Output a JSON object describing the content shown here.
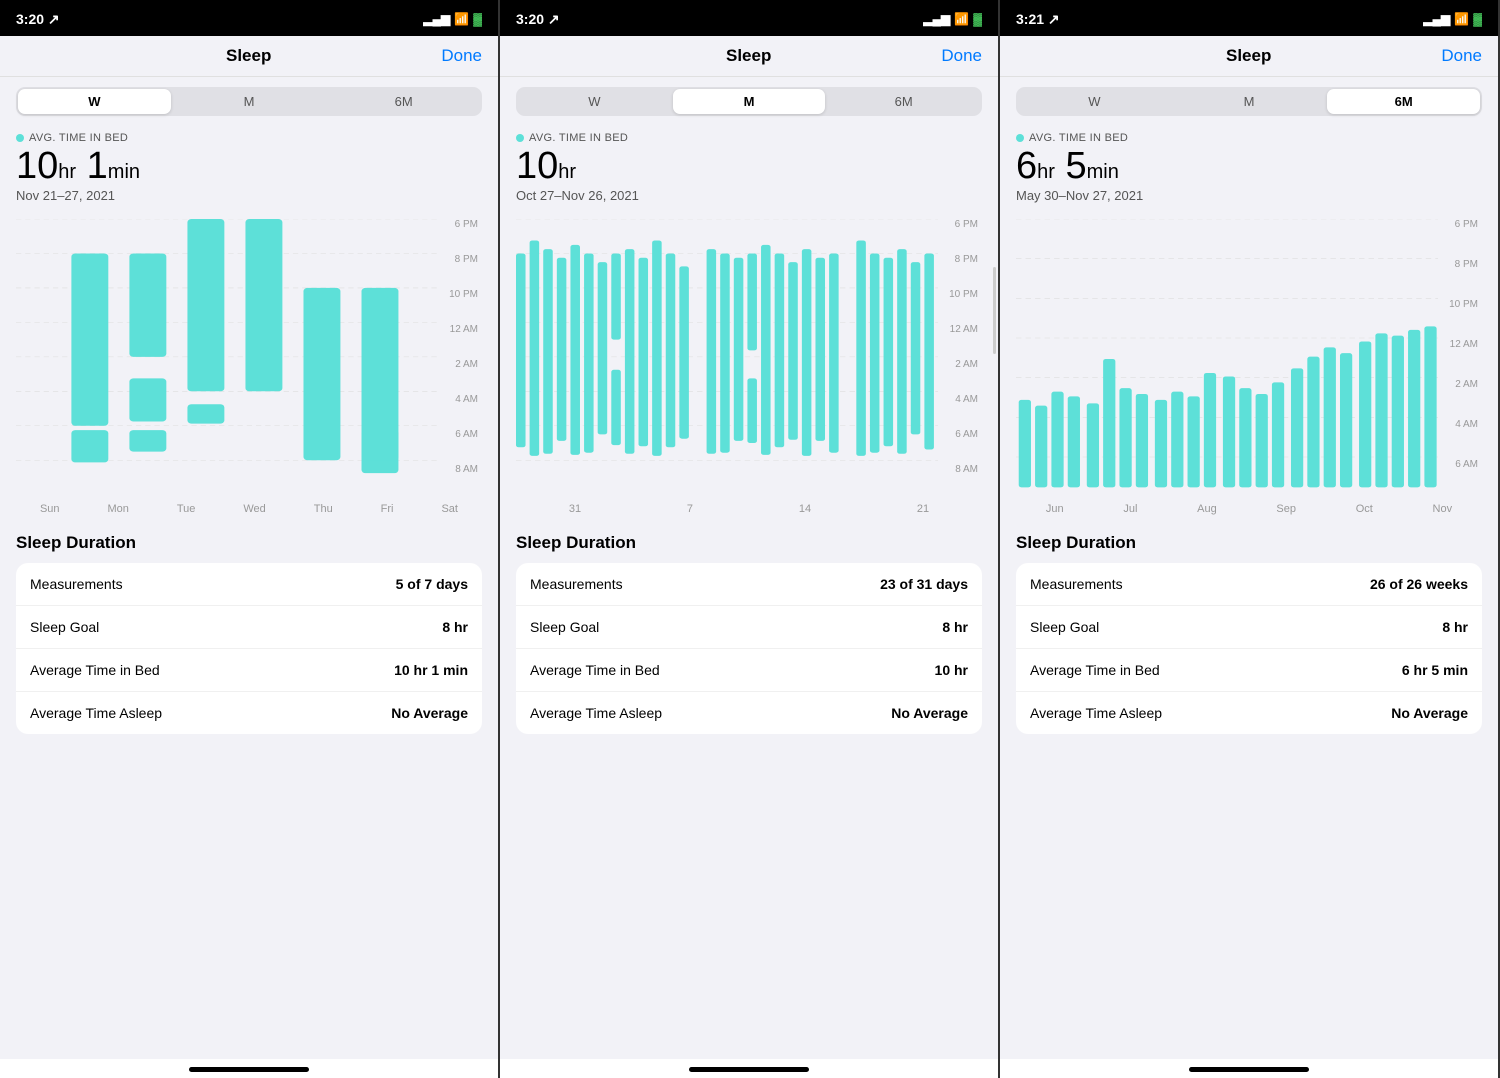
{
  "screens": [
    {
      "id": "weekly",
      "statusBar": {
        "time": "3:20",
        "locationIcon": "↗",
        "signal": "▂▄▆",
        "wifi": "wifi",
        "battery": "🔋"
      },
      "nav": {
        "title": "Sleep",
        "doneLabel": "Done"
      },
      "segments": [
        "W",
        "M",
        "6M"
      ],
      "activeSegment": 0,
      "avgLabel": "AVG. TIME IN BED",
      "bigValue": "10",
      "bigValueUnit": "hr",
      "bigValueMin": "1",
      "bigValueMinUnit": "min",
      "dateRange": "Nov 21–27, 2021",
      "timeLabels": [
        "6 PM",
        "8 PM",
        "10 PM",
        "12 AM",
        "2 AM",
        "4 AM",
        "6 AM",
        "8 AM"
      ],
      "xLabels": [
        "Sun",
        "Mon",
        "Tue",
        "Wed",
        "Thu",
        "Fri",
        "Sat"
      ],
      "statsTitle": "Sleep Duration",
      "stats": [
        {
          "label": "Measurements",
          "value": "5 of 7 days"
        },
        {
          "label": "Sleep Goal",
          "value": "8 hr"
        },
        {
          "label": "Average Time in Bed",
          "value": "10 hr 1 min"
        },
        {
          "label": "Average Time Asleep",
          "value": "No Average"
        }
      ]
    },
    {
      "id": "monthly",
      "statusBar": {
        "time": "3:20",
        "locationIcon": "↗"
      },
      "nav": {
        "title": "Sleep",
        "doneLabel": "Done"
      },
      "segments": [
        "W",
        "M",
        "6M"
      ],
      "activeSegment": 1,
      "avgLabel": "AVG. TIME IN BED",
      "bigValue": "10",
      "bigValueUnit": "hr",
      "bigValueMin": "",
      "bigValueMinUnit": "",
      "dateRange": "Oct 27–Nov 26, 2021",
      "timeLabels": [
        "6 PM",
        "8 PM",
        "10 PM",
        "12 AM",
        "2 AM",
        "4 AM",
        "6 AM",
        "8 AM"
      ],
      "xLabels": [
        "31",
        "7",
        "14",
        "21"
      ],
      "statsTitle": "Sleep Duration",
      "stats": [
        {
          "label": "Measurements",
          "value": "23 of 31 days"
        },
        {
          "label": "Sleep Goal",
          "value": "8 hr"
        },
        {
          "label": "Average Time in Bed",
          "value": "10 hr"
        },
        {
          "label": "Average Time Asleep",
          "value": "No Average"
        }
      ],
      "hasScrollbar": true
    },
    {
      "id": "sixmonth",
      "statusBar": {
        "time": "3:21",
        "locationIcon": "↗"
      },
      "nav": {
        "title": "Sleep",
        "doneLabel": "Done"
      },
      "segments": [
        "W",
        "M",
        "6M"
      ],
      "activeSegment": 2,
      "avgLabel": "AVG. TIME IN BED",
      "bigValue": "6",
      "bigValueUnit": "hr",
      "bigValueMin": "5",
      "bigValueMinUnit": "min",
      "dateRange": "May 30–Nov 27, 2021",
      "timeLabels": [
        "6 PM",
        "8 PM",
        "10 PM",
        "12 AM",
        "2 AM",
        "4 AM",
        "6 AM"
      ],
      "xLabels": [
        "Jun",
        "Jul",
        "Aug",
        "Sep",
        "Oct",
        "Nov"
      ],
      "statsTitle": "Sleep Duration",
      "stats": [
        {
          "label": "Measurements",
          "value": "26 of 26 weeks"
        },
        {
          "label": "Sleep Goal",
          "value": "8 hr"
        },
        {
          "label": "Average Time in Bed",
          "value": "6 hr 5 min"
        },
        {
          "label": "Average Time Asleep",
          "value": "No Average"
        }
      ]
    }
  ]
}
